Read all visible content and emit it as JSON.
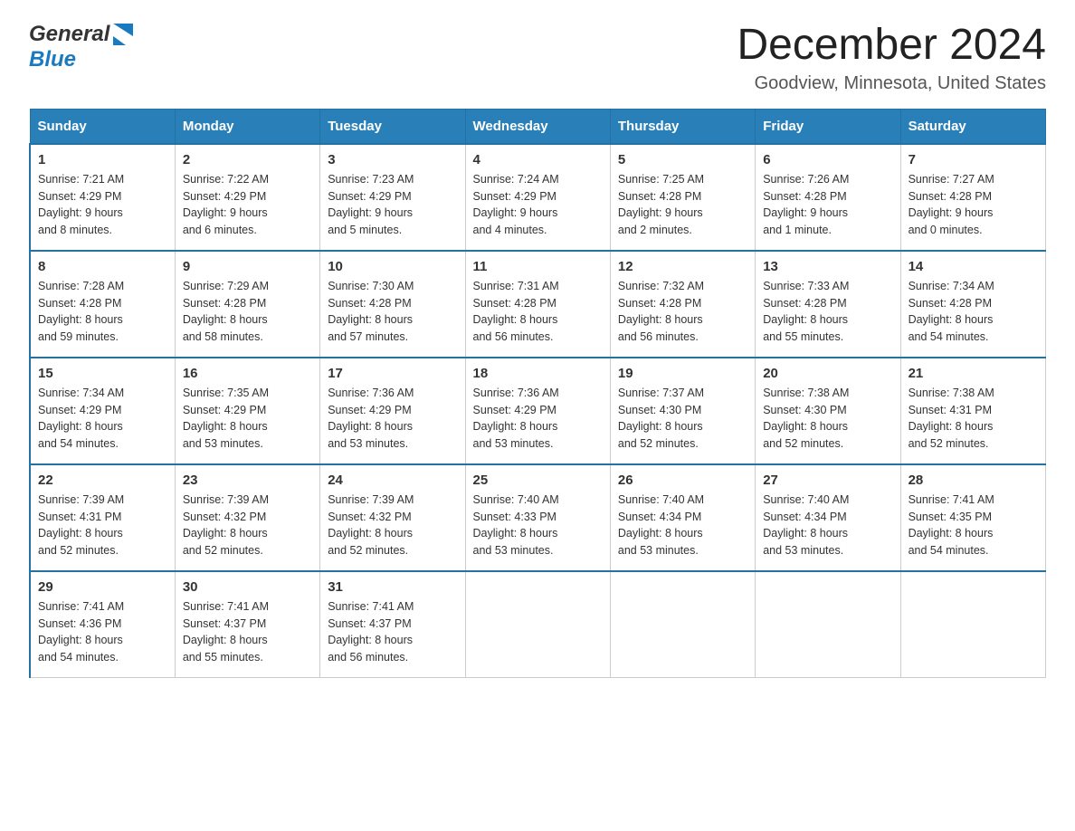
{
  "header": {
    "logo_general": "General",
    "logo_blue": "Blue",
    "title": "December 2024",
    "subtitle": "Goodview, Minnesota, United States"
  },
  "days_of_week": [
    "Sunday",
    "Monday",
    "Tuesday",
    "Wednesday",
    "Thursday",
    "Friday",
    "Saturday"
  ],
  "weeks": [
    [
      {
        "date": "1",
        "sunrise": "7:21 AM",
        "sunset": "4:29 PM",
        "daylight": "9 hours and 8 minutes."
      },
      {
        "date": "2",
        "sunrise": "7:22 AM",
        "sunset": "4:29 PM",
        "daylight": "9 hours and 6 minutes."
      },
      {
        "date": "3",
        "sunrise": "7:23 AM",
        "sunset": "4:29 PM",
        "daylight": "9 hours and 5 minutes."
      },
      {
        "date": "4",
        "sunrise": "7:24 AM",
        "sunset": "4:29 PM",
        "daylight": "9 hours and 4 minutes."
      },
      {
        "date": "5",
        "sunrise": "7:25 AM",
        "sunset": "4:28 PM",
        "daylight": "9 hours and 2 minutes."
      },
      {
        "date": "6",
        "sunrise": "7:26 AM",
        "sunset": "4:28 PM",
        "daylight": "9 hours and 1 minute."
      },
      {
        "date": "7",
        "sunrise": "7:27 AM",
        "sunset": "4:28 PM",
        "daylight": "9 hours and 0 minutes."
      }
    ],
    [
      {
        "date": "8",
        "sunrise": "7:28 AM",
        "sunset": "4:28 PM",
        "daylight": "8 hours and 59 minutes."
      },
      {
        "date": "9",
        "sunrise": "7:29 AM",
        "sunset": "4:28 PM",
        "daylight": "8 hours and 58 minutes."
      },
      {
        "date": "10",
        "sunrise": "7:30 AM",
        "sunset": "4:28 PM",
        "daylight": "8 hours and 57 minutes."
      },
      {
        "date": "11",
        "sunrise": "7:31 AM",
        "sunset": "4:28 PM",
        "daylight": "8 hours and 56 minutes."
      },
      {
        "date": "12",
        "sunrise": "7:32 AM",
        "sunset": "4:28 PM",
        "daylight": "8 hours and 56 minutes."
      },
      {
        "date": "13",
        "sunrise": "7:33 AM",
        "sunset": "4:28 PM",
        "daylight": "8 hours and 55 minutes."
      },
      {
        "date": "14",
        "sunrise": "7:34 AM",
        "sunset": "4:28 PM",
        "daylight": "8 hours and 54 minutes."
      }
    ],
    [
      {
        "date": "15",
        "sunrise": "7:34 AM",
        "sunset": "4:29 PM",
        "daylight": "8 hours and 54 minutes."
      },
      {
        "date": "16",
        "sunrise": "7:35 AM",
        "sunset": "4:29 PM",
        "daylight": "8 hours and 53 minutes."
      },
      {
        "date": "17",
        "sunrise": "7:36 AM",
        "sunset": "4:29 PM",
        "daylight": "8 hours and 53 minutes."
      },
      {
        "date": "18",
        "sunrise": "7:36 AM",
        "sunset": "4:29 PM",
        "daylight": "8 hours and 53 minutes."
      },
      {
        "date": "19",
        "sunrise": "7:37 AM",
        "sunset": "4:30 PM",
        "daylight": "8 hours and 52 minutes."
      },
      {
        "date": "20",
        "sunrise": "7:38 AM",
        "sunset": "4:30 PM",
        "daylight": "8 hours and 52 minutes."
      },
      {
        "date": "21",
        "sunrise": "7:38 AM",
        "sunset": "4:31 PM",
        "daylight": "8 hours and 52 minutes."
      }
    ],
    [
      {
        "date": "22",
        "sunrise": "7:39 AM",
        "sunset": "4:31 PM",
        "daylight": "8 hours and 52 minutes."
      },
      {
        "date": "23",
        "sunrise": "7:39 AM",
        "sunset": "4:32 PM",
        "daylight": "8 hours and 52 minutes."
      },
      {
        "date": "24",
        "sunrise": "7:39 AM",
        "sunset": "4:32 PM",
        "daylight": "8 hours and 52 minutes."
      },
      {
        "date": "25",
        "sunrise": "7:40 AM",
        "sunset": "4:33 PM",
        "daylight": "8 hours and 53 minutes."
      },
      {
        "date": "26",
        "sunrise": "7:40 AM",
        "sunset": "4:34 PM",
        "daylight": "8 hours and 53 minutes."
      },
      {
        "date": "27",
        "sunrise": "7:40 AM",
        "sunset": "4:34 PM",
        "daylight": "8 hours and 53 minutes."
      },
      {
        "date": "28",
        "sunrise": "7:41 AM",
        "sunset": "4:35 PM",
        "daylight": "8 hours and 54 minutes."
      }
    ],
    [
      {
        "date": "29",
        "sunrise": "7:41 AM",
        "sunset": "4:36 PM",
        "daylight": "8 hours and 54 minutes."
      },
      {
        "date": "30",
        "sunrise": "7:41 AM",
        "sunset": "4:37 PM",
        "daylight": "8 hours and 55 minutes."
      },
      {
        "date": "31",
        "sunrise": "7:41 AM",
        "sunset": "4:37 PM",
        "daylight": "8 hours and 56 minutes."
      },
      {
        "date": "",
        "sunrise": "",
        "sunset": "",
        "daylight": ""
      },
      {
        "date": "",
        "sunrise": "",
        "sunset": "",
        "daylight": ""
      },
      {
        "date": "",
        "sunrise": "",
        "sunset": "",
        "daylight": ""
      },
      {
        "date": "",
        "sunrise": "",
        "sunset": "",
        "daylight": ""
      }
    ]
  ],
  "labels": {
    "sunrise": "Sunrise:",
    "sunset": "Sunset:",
    "daylight": "Daylight:"
  }
}
